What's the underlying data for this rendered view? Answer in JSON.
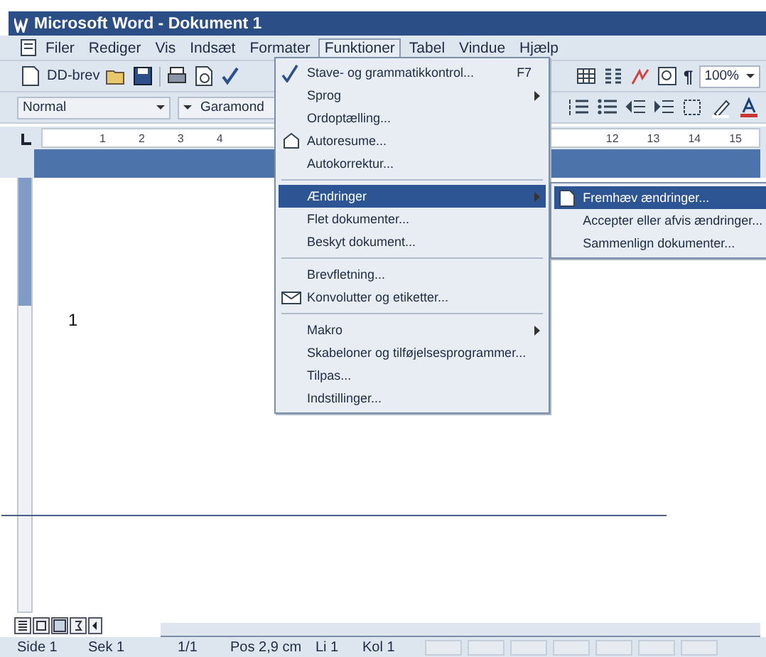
{
  "window": {
    "title": "Microsoft Word - Dokument 1"
  },
  "menubar": [
    {
      "label": "Filer",
      "selected": false
    },
    {
      "label": "Rediger",
      "selected": false
    },
    {
      "label": "Vis",
      "selected": false
    },
    {
      "label": "Indsæt",
      "selected": false
    },
    {
      "label": "Formater",
      "selected": false
    },
    {
      "label": "Funktioner",
      "selected": true
    },
    {
      "label": "Tabel",
      "selected": false
    },
    {
      "label": "Vindue",
      "selected": false
    },
    {
      "label": "Hjælp",
      "selected": false
    }
  ],
  "toolbar": {
    "letter_button": "DD-brev",
    "pilcrow": "¶",
    "zoom": "100%"
  },
  "formatting": {
    "style": "Normal",
    "font": "Garamond"
  },
  "ruler": {
    "left_numbers": [
      "1",
      "2",
      "3",
      "4"
    ],
    "right_numbers": [
      "12",
      "13",
      "14",
      "15"
    ]
  },
  "document": {
    "page_number": "1"
  },
  "menu": {
    "groups": [
      [
        {
          "label": "Stave- og grammatikkontrol...",
          "shortcut": "F7",
          "submenu": false,
          "selected": false
        },
        {
          "label": "Sprog",
          "submenu": true,
          "selected": false
        },
        {
          "label": "Ordoptælling...",
          "submenu": false,
          "selected": false
        },
        {
          "label": "Autoresume...",
          "submenu": false,
          "selected": false
        },
        {
          "label": "Autokorrektur...",
          "submenu": false,
          "selected": false
        }
      ],
      [
        {
          "label": "Ændringer",
          "submenu": true,
          "selected": true
        },
        {
          "label": "Flet dokumenter...",
          "submenu": false,
          "selected": false
        },
        {
          "label": "Beskyt dokument...",
          "submenu": false,
          "selected": false
        }
      ],
      [
        {
          "label": "Brevfletning...",
          "submenu": false,
          "selected": false
        },
        {
          "label": "Konvolutter og etiketter...",
          "submenu": false,
          "selected": false
        }
      ],
      [
        {
          "label": "Makro",
          "submenu": true,
          "selected": false
        },
        {
          "label": "Skabeloner og tilføjelsesprogrammer...",
          "submenu": false,
          "selected": false
        },
        {
          "label": "Tilpas...",
          "submenu": false,
          "selected": false
        },
        {
          "label": "Indstillinger...",
          "submenu": false,
          "selected": false
        }
      ]
    ]
  },
  "submenu": {
    "items": [
      {
        "label": "Fremhæv ændringer...",
        "selected": true
      },
      {
        "label": "Accepter eller afvis ændringer...",
        "selected": false
      },
      {
        "label": "Sammenlign dokumenter...",
        "selected": false
      }
    ]
  },
  "status_bar": [
    "Side 1",
    "Sek 1",
    "1/1",
    "Pos 2,9 cm",
    "Li 1",
    "Kol 1"
  ]
}
